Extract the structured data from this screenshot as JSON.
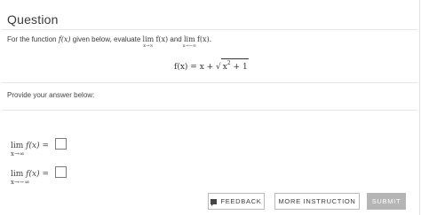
{
  "header": {
    "title": "Question"
  },
  "question": {
    "prompt_pre": "For the function",
    "fx": "f(x)",
    "prompt_mid": "given below, evaluate",
    "lim1_word": "lim",
    "lim1_sub": "x→∞",
    "lim1_expr": "f(x)",
    "and_word": "and",
    "lim2_word": "lim",
    "lim2_sub": "x→−∞",
    "lim2_expr": "f(x).",
    "formula_left": "f(x) = x + ",
    "formula_radicand_x": "x",
    "formula_radicand_exp": "2",
    "formula_radicand_rest": " + 1"
  },
  "answer": {
    "provide_label": "Provide your answer below:",
    "row1": {
      "lim": "lim",
      "expr": "f(x) =",
      "sub": "x→∞"
    },
    "row2": {
      "lim": "lim",
      "expr": "f(x) =",
      "sub": "x→−∞"
    }
  },
  "buttons": {
    "feedback": "FEEDBACK",
    "more_instruction": "MORE INSTRUCTION",
    "submit": "SUBMIT"
  },
  "icons": {
    "feedback": "speech-bubble-icon"
  }
}
